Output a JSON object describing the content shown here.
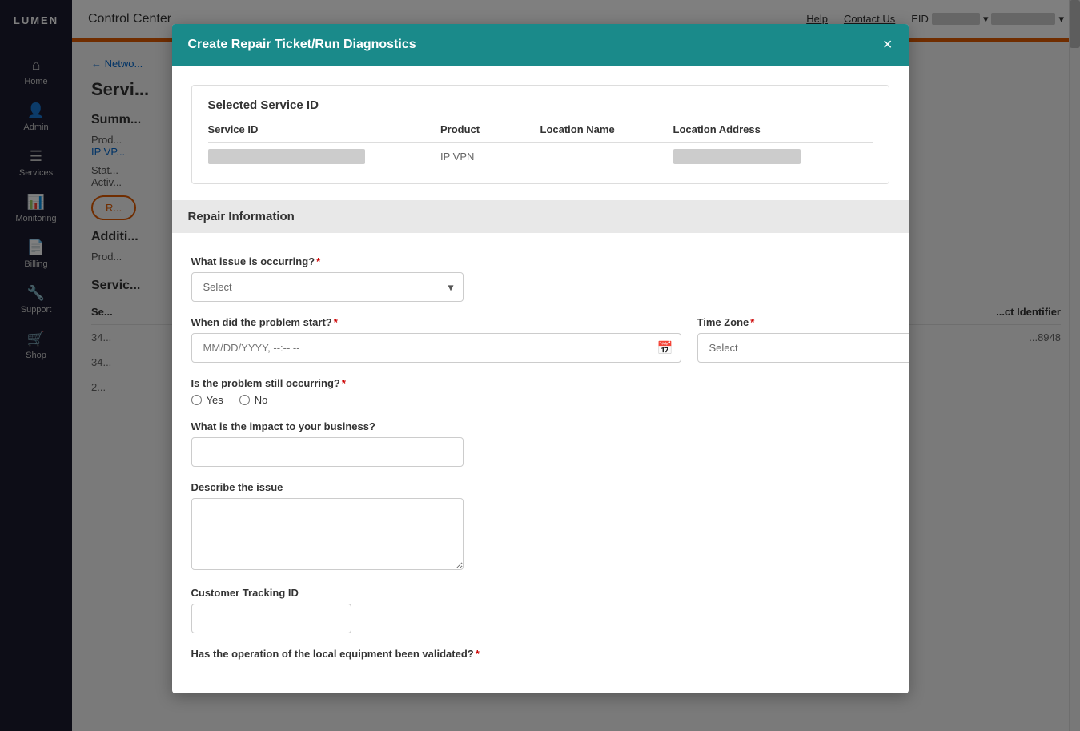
{
  "app": {
    "logo": "LUMEN",
    "topbar": {
      "title": "Control Center",
      "help": "Help",
      "contact_us": "Contact Us",
      "eid_label": "EID"
    }
  },
  "sidebar": {
    "items": [
      {
        "id": "home",
        "label": "Home",
        "icon": "⌂"
      },
      {
        "id": "admin",
        "label": "Admin",
        "icon": "👤"
      },
      {
        "id": "services",
        "label": "Services",
        "icon": "☰"
      },
      {
        "id": "monitoring",
        "label": "Monitoring",
        "icon": "📊"
      },
      {
        "id": "billing",
        "label": "Billing",
        "icon": "📄"
      },
      {
        "id": "support",
        "label": "Support",
        "icon": "🔧"
      },
      {
        "id": "shop",
        "label": "Shop",
        "icon": "🛒"
      }
    ]
  },
  "page": {
    "breadcrumb": "← Netwo...",
    "title": "Servi...",
    "summary_title": "Summ...",
    "product_label": "Prod...",
    "product_value": "IP VP...",
    "status_label": "Stat...",
    "status_value": "Activ...",
    "additional_title": "Additi...",
    "services_title": "Servic...",
    "service_col": "Se...",
    "identifier_col": "...ct Identifier",
    "row1_service": "34...",
    "row1_identifier": "...8948",
    "row2_service": "34...",
    "row3_service": "2..."
  },
  "modal": {
    "title": "Create Repair Ticket/Run Diagnostics",
    "close_label": "×",
    "service_id_section": {
      "title": "Selected Service ID",
      "columns": [
        "Service ID",
        "Product",
        "Location Name",
        "Location Address"
      ],
      "rows": [
        {
          "service_id": "██████████████████",
          "product": "IP VPN",
          "location_name": "",
          "location_address": "███ ████████████ ██"
        }
      ]
    },
    "repair_section": {
      "title": "Repair Information"
    },
    "form": {
      "issue_label": "What issue is occurring?",
      "issue_required": true,
      "issue_placeholder": "Select",
      "problem_start_label": "When did the problem start?",
      "problem_start_required": true,
      "problem_start_placeholder": "MM/DD/YYYY, --:-- --",
      "timezone_label": "Time Zone",
      "timezone_required": true,
      "timezone_placeholder": "Select",
      "still_occurring_label": "Is the problem still occurring?",
      "still_occurring_required": true,
      "yes_label": "Yes",
      "no_label": "No",
      "impact_label": "What is the impact to your business?",
      "impact_required": false,
      "describe_label": "Describe the issue",
      "describe_required": false,
      "tracking_label": "Customer Tracking ID",
      "tracking_required": false,
      "local_equipment_label": "Has the operation of the local equipment been validated?",
      "local_equipment_required": true
    }
  }
}
